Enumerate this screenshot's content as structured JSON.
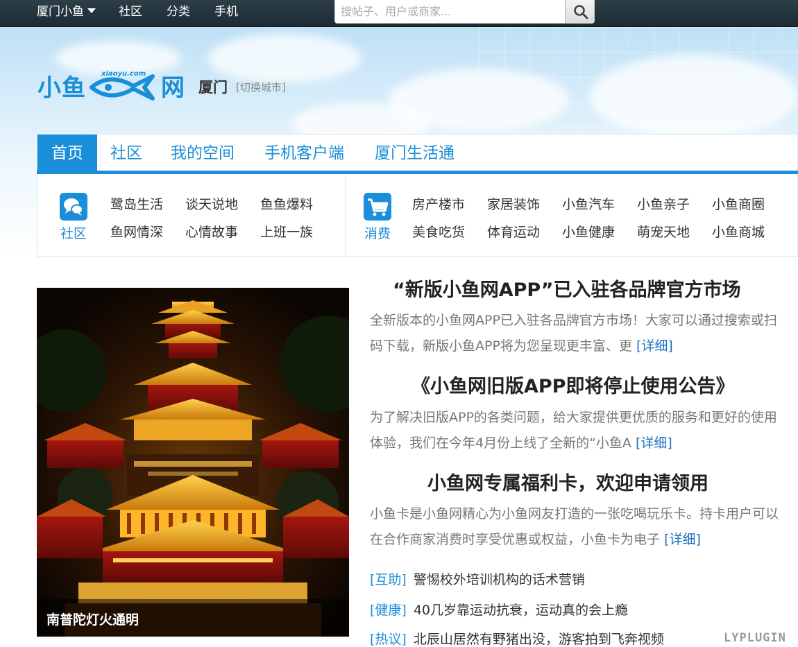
{
  "topbar": {
    "items": [
      {
        "label": "厦门小鱼"
      },
      {
        "label": "社区"
      },
      {
        "label": "分类"
      },
      {
        "label": "手机"
      }
    ],
    "search_placeholder": "搜帖子、用户或商家..."
  },
  "header": {
    "logo_text_left": "小鱼",
    "logo_text_right": "网",
    "logo_domain": "xiaoyu.com",
    "city": "厦门",
    "switch_city": "[切换城市]"
  },
  "mainnav": {
    "tabs": [
      {
        "label": "首页",
        "active": true
      },
      {
        "label": "社区"
      },
      {
        "label": "我的空间"
      },
      {
        "label": "手机客户端"
      },
      {
        "label": "厦门生活通"
      }
    ]
  },
  "categories": {
    "community": {
      "label": "社区",
      "icon": "chat-bubbles-icon",
      "links": [
        "鹭岛生活",
        "谈天说地",
        "鱼鱼爆料",
        "鱼网情深",
        "心情故事",
        "上班一族"
      ]
    },
    "consume": {
      "label": "消费",
      "icon": "shopping-cart-icon",
      "links": [
        "房产楼市",
        "家居装饰",
        "小鱼汽车",
        "小鱼亲子",
        "小鱼商圈",
        "美食吃货",
        "体育运动",
        "小鱼健康",
        "萌宠天地",
        "小鱼商城"
      ]
    }
  },
  "feature": {
    "caption": "南普陀灯火通明"
  },
  "articles": [
    {
      "title": "“新版小鱼网APP”已入驻各品牌官方市场",
      "body": "全新版本的小鱼网APP已入驻各品牌官方市场！大家可以通过搜索或扫码下载，新版小鱼APP将为您呈现更丰富、更",
      "more": "[详细]"
    },
    {
      "title": "《小鱼网旧版APP即将停止使用公告》",
      "body": "为了解决旧版APP的各类问题，给大家提供更优质的服务和更好的使用体验，我们在今年4月份上线了全新的“小鱼A",
      "more": "[详细]"
    },
    {
      "title": "小鱼网专属福利卡，欢迎申请领用",
      "body": "小鱼卡是小鱼网精心为小鱼网友打造的一张吃喝玩乐卡。持卡用户可以在合作商家消费时享受优惠或权益，小鱼卡为电子",
      "more": "[详细]"
    }
  ],
  "news": [
    {
      "tag": "[互助]",
      "text": "警惕校外培训机构的话术营销"
    },
    {
      "tag": "[健康]",
      "text": "40几岁靠运动抗衰，运动真的会上瘾"
    },
    {
      "tag": "[热议]",
      "text": "北辰山居然有野猪出没，游客拍到飞奔视频"
    }
  ],
  "watermark": "LYPLUGIN",
  "colors": {
    "brand_blue": "#1a8ed8",
    "topbar": "#22323b",
    "link_blue": "#1a6fc2"
  }
}
